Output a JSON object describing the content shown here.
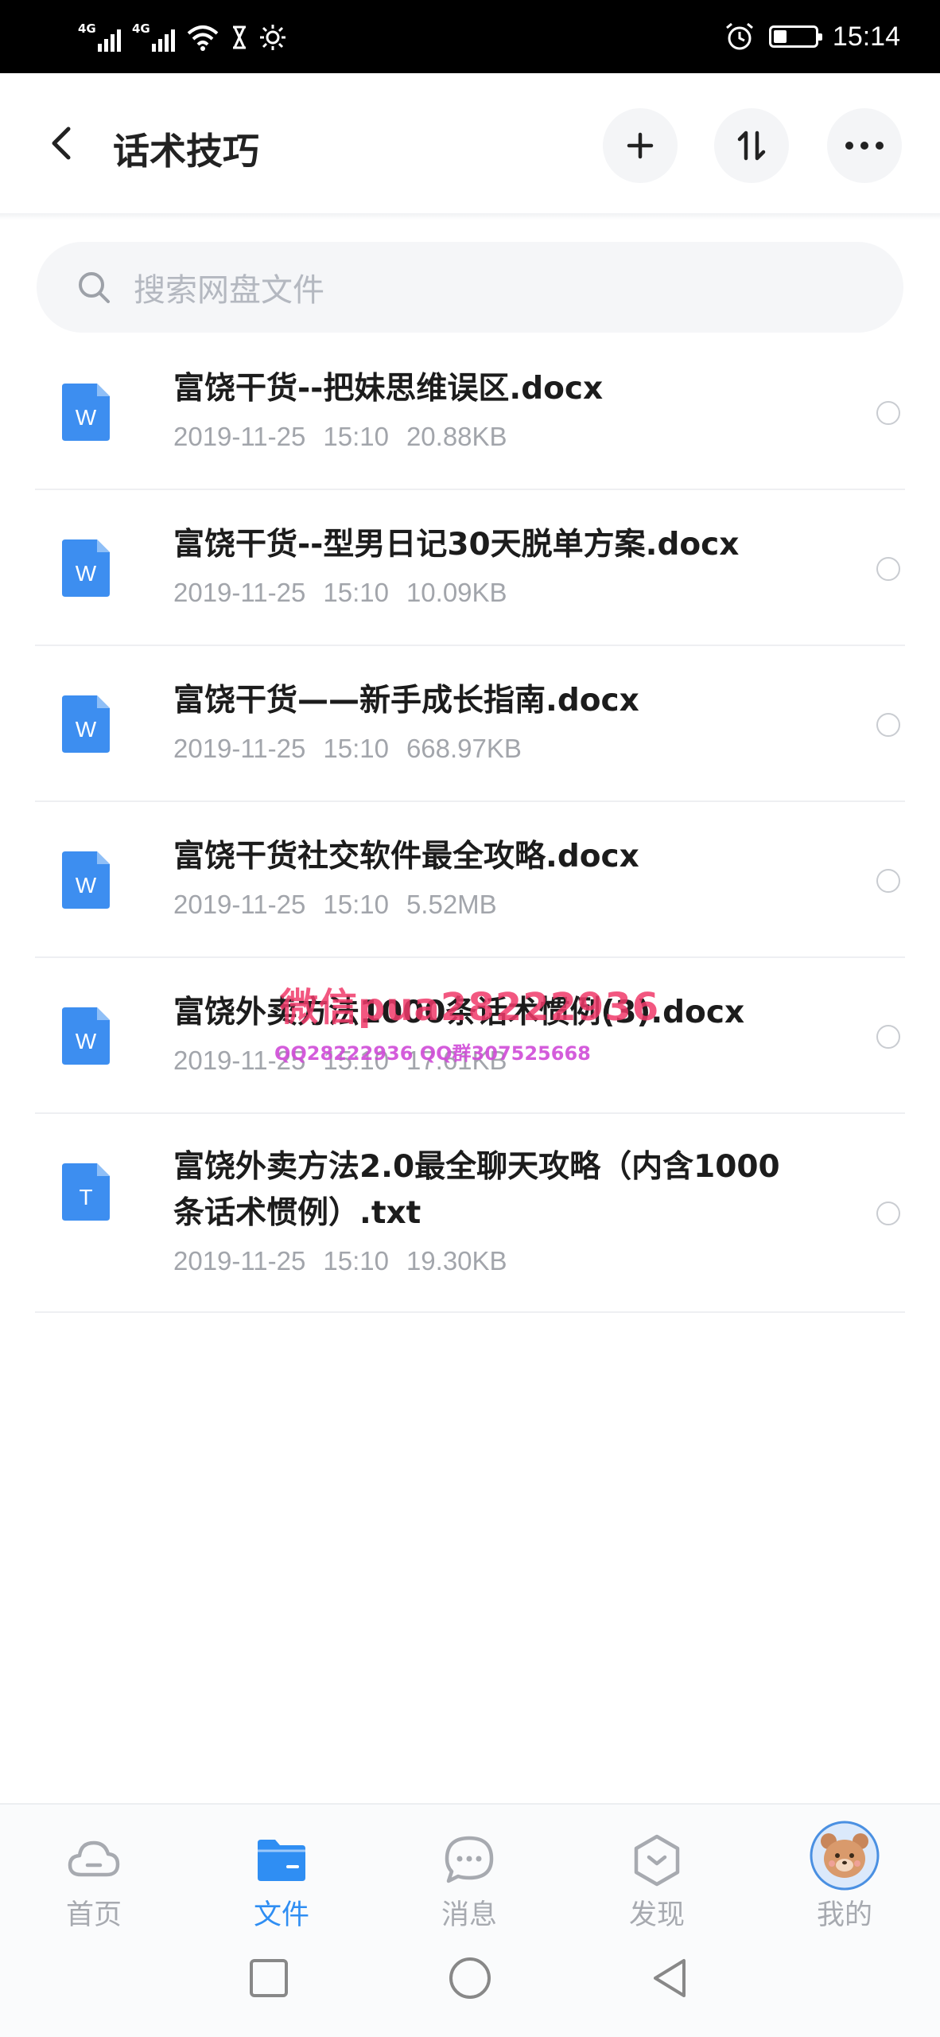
{
  "status_bar": {
    "signal1": "4G",
    "signal2": "4G",
    "time": "15:14"
  },
  "header": {
    "title": "话术技巧",
    "actions": [
      "add-icon",
      "sort-icon",
      "more-icon"
    ]
  },
  "search": {
    "placeholder": "搜索网盘文件"
  },
  "files": [
    {
      "type": "W",
      "name": "富饶干货--把妹思维误区.docx",
      "date": "2019-11-25",
      "time": "15:10",
      "size": "20.88KB"
    },
    {
      "type": "W",
      "name": "富饶干货--型男日记30天脱单方案.docx",
      "date": "2019-11-25",
      "time": "15:10",
      "size": "10.09KB"
    },
    {
      "type": "W",
      "name": "富饶干货——新手成长指南.docx",
      "date": "2019-11-25",
      "time": "15:10",
      "size": "668.97KB"
    },
    {
      "type": "W",
      "name": "富饶干货社交软件最全攻略.docx",
      "date": "2019-11-25",
      "time": "15:10",
      "size": "5.52MB"
    },
    {
      "type": "W",
      "name": "富饶外卖方法1000条话术惯例(3).docx",
      "date": "2019-11-25",
      "time": "15:10",
      "size": "17.61KB"
    },
    {
      "type": "T",
      "name": "富饶外卖方法2.0最全聊天攻略（内含1000条话术惯例）.txt",
      "date": "2019-11-25",
      "time": "15:10",
      "size": "19.30KB"
    }
  ],
  "watermark": {
    "line1": "微信pua28222936",
    "line2": "QQ28222936 QQ群307525668"
  },
  "bottom_nav": [
    {
      "label": "首页",
      "icon": "cloud-icon",
      "active": false
    },
    {
      "label": "文件",
      "icon": "folder-icon",
      "active": true
    },
    {
      "label": "消息",
      "icon": "message-icon",
      "active": false
    },
    {
      "label": "发现",
      "icon": "discover-icon",
      "active": false
    },
    {
      "label": "我的",
      "icon": "avatar-icon",
      "active": false
    }
  ],
  "colors": {
    "accent": "#2f8ef3",
    "word_icon": "#3d8ef0",
    "txt_icon": "#3d8ef0",
    "watermark": "#f03a6a"
  }
}
